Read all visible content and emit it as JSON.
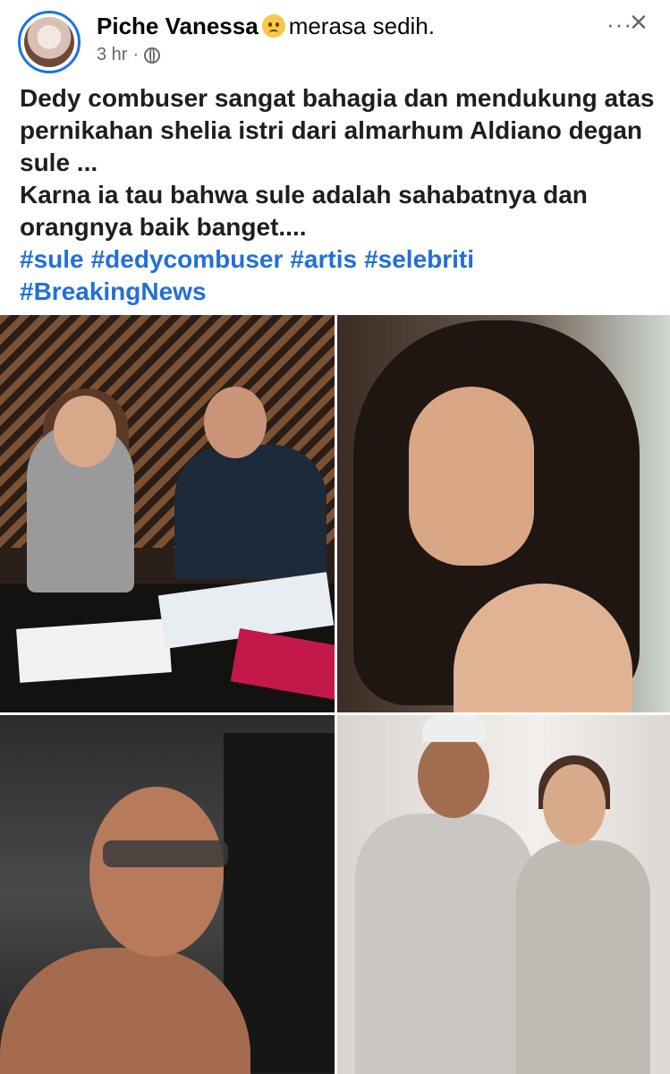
{
  "header": {
    "author": "Piche Vanessa",
    "feeling_icon": "sad-face-emoji",
    "feeling_text": "merasa sedih.",
    "time": "3 hr",
    "separator": "·",
    "audience_icon": "globe-icon",
    "menu_label": "···",
    "close_label": "×"
  },
  "post": {
    "line1": "Dedy combuser sangat bahagia dan mendukung atas pernikahan shelia istri dari almarhum Aldiano degan sule ...",
    "line2": "Karna ia tau bahwa sule adalah sahabatnya dan orangnya baik banget....",
    "hashtags": [
      "#sule",
      "#dedycombuser",
      "#artis",
      "#selebriti",
      "#BreakingNews"
    ]
  },
  "colors": {
    "link": "#216fdb",
    "avatar_ring": "#1b74e4",
    "secondary_text": "#65676b"
  }
}
